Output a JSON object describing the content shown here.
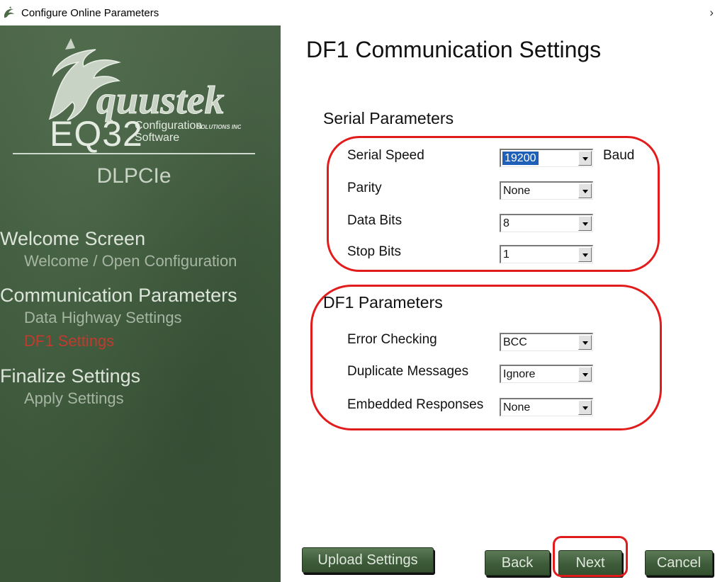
{
  "window": {
    "title": "Configure Online Parameters",
    "close_glyph": "›",
    "icon": "equustek-app-icon"
  },
  "sidebar": {
    "logo_text": "quustek",
    "logo_subtext": "SOLUTIONS INC.",
    "app_name": "EQ32",
    "app_subtitle_1": "Configuration",
    "app_subtitle_2": "Software",
    "product": "DLPCIe",
    "sections": [
      {
        "heading": "Welcome Screen",
        "items": [
          "Welcome / Open Configuration"
        ]
      },
      {
        "heading": "Communication Parameters",
        "items": [
          "Data Highway Settings",
          "DF1 Settings"
        ]
      },
      {
        "heading": "Finalize Settings",
        "items": [
          "Apply Settings"
        ]
      }
    ],
    "active_item": "DF1 Settings",
    "colors": {
      "active": "#c23a2e",
      "background": "#3f5a3e"
    }
  },
  "main": {
    "heading": "DF1 Communication Settings",
    "serial": {
      "title": "Serial Parameters",
      "fields": [
        {
          "label": "Serial Speed",
          "value": "19200",
          "unit": "Baud"
        },
        {
          "label": "Parity",
          "value": "None"
        },
        {
          "label": "Data Bits",
          "value": "8"
        },
        {
          "label": "Stop Bits",
          "value": "1"
        }
      ]
    },
    "df1": {
      "title": "DF1 Parameters",
      "fields": [
        {
          "label": "Error Checking",
          "value": "BCC"
        },
        {
          "label": "Duplicate Messages",
          "value": "Ignore"
        },
        {
          "label": "Embedded Responses",
          "value": "None"
        }
      ]
    }
  },
  "buttons": {
    "upload": "Upload Settings",
    "back": "Back",
    "next": "Next",
    "cancel": "Cancel"
  },
  "annotation_color": "#e21c1c"
}
